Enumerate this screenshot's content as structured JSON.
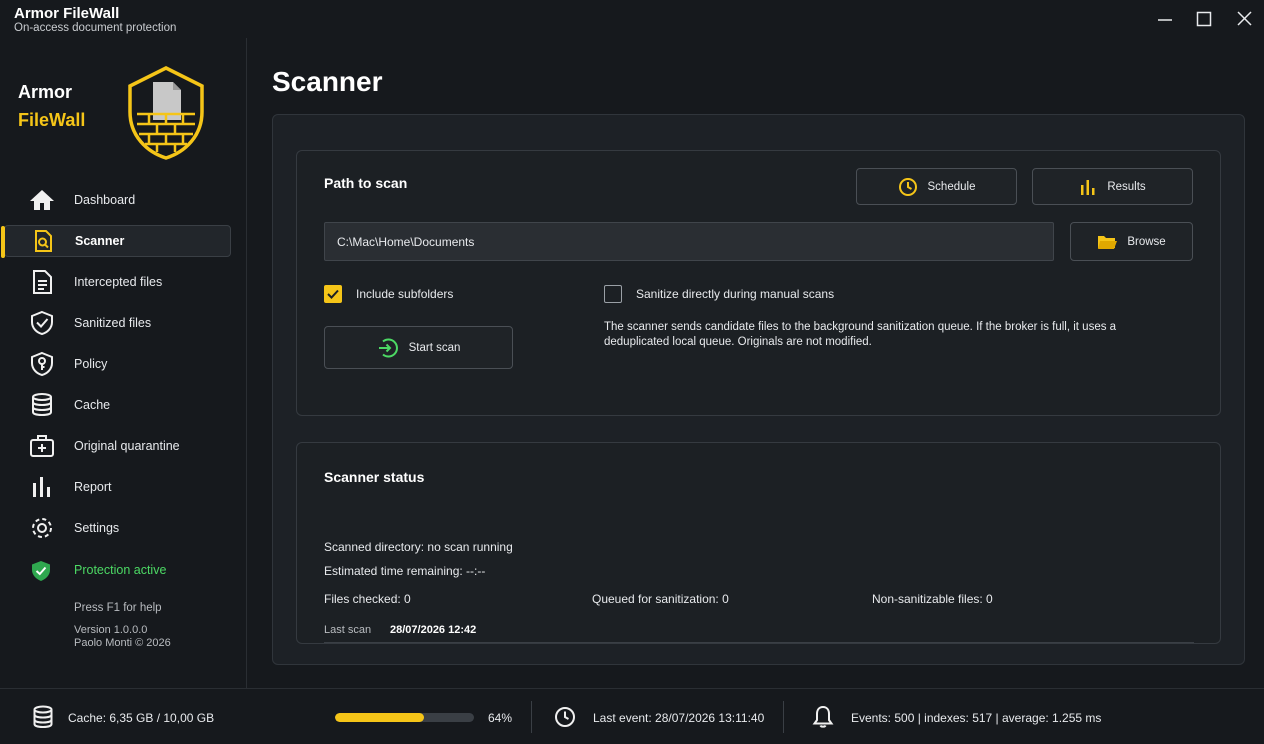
{
  "window": {
    "title": "Armor FileWall",
    "subtitle": "On-access document protection"
  },
  "brand": {
    "line1": "Armor",
    "line2": "FileWall"
  },
  "sidebar": {
    "items": [
      {
        "label": "Dashboard",
        "icon": "home-icon",
        "active": false
      },
      {
        "label": "Scanner",
        "icon": "scanner-icon",
        "active": true
      },
      {
        "label": "Intercepted files",
        "icon": "document-icon",
        "active": false
      },
      {
        "label": "Sanitized files",
        "icon": "shield-check-icon",
        "active": false
      },
      {
        "label": "Policy",
        "icon": "shield-key-icon",
        "active": false
      },
      {
        "label": "Cache",
        "icon": "database-icon",
        "active": false
      },
      {
        "label": "Original quarantine",
        "icon": "medkit-icon",
        "active": false
      },
      {
        "label": "Report",
        "icon": "bar-chart-icon",
        "active": false
      },
      {
        "label": "Settings",
        "icon": "gear-icon",
        "active": false
      }
    ],
    "protection": "Protection active",
    "help": "Press F1 for help",
    "version": "Version 1.0.0.0",
    "author": "Paolo Monti © 2026"
  },
  "main": {
    "title": "Scanner",
    "path_section": {
      "heading": "Path to scan",
      "schedule_label": "Schedule",
      "results_label": "Results",
      "path_value": "C:\\Mac\\Home\\Documents",
      "browse_label": "Browse",
      "include_subfolders_label": "Include subfolders",
      "include_subfolders_checked": true,
      "sanitize_direct_label": "Sanitize directly during manual scans",
      "sanitize_direct_checked": false,
      "start_scan_label": "Start scan",
      "info": "The scanner sends candidate files to the background sanitization queue. If the broker is full, it uses a deduplicated local queue. Originals are not modified."
    },
    "status_section": {
      "heading": "Scanner status",
      "scanned_directory": "Scanned directory: no scan running",
      "time_remaining": "Estimated time remaining: --:--",
      "files_checked": "Files checked: 0",
      "queued": "Queued for sanitization: 0",
      "non_sanitizable": "Non-sanitizable files: 0",
      "last_scan_label": "Last scan",
      "last_scan_value": "28/07/2026 12:42"
    }
  },
  "statusbar": {
    "cache": "Cache: 6,35 GB / 10,00 GB",
    "cache_percent_label": "64%",
    "cache_fraction": 0.64,
    "last_event": "Last event: 28/07/2026 13:11:40",
    "events": "Events: 500  |  indexes: 517  |  average: 1.255 ms"
  },
  "colors": {
    "accent": "#f5c518",
    "success": "#4cd964",
    "background": "#16191d"
  }
}
